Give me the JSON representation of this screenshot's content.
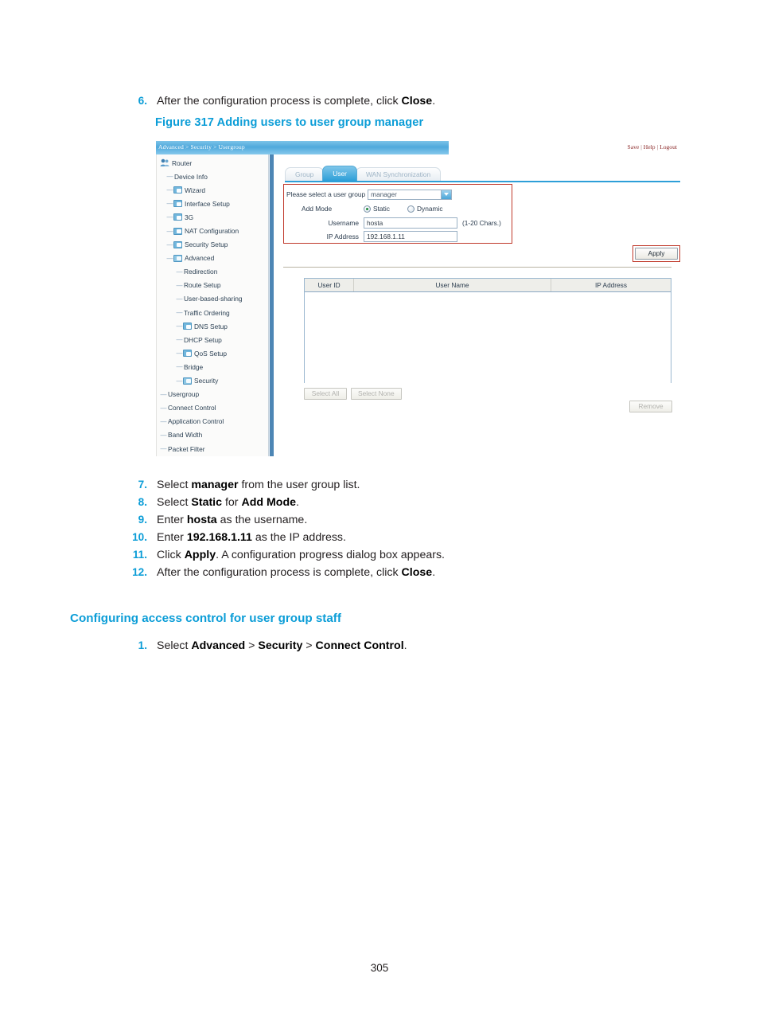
{
  "document": {
    "page_number": "305",
    "figure_caption": "Figure 317 Adding users to user group manager",
    "section_heading": "Configuring access control for user group staff",
    "steps_before_figure": [
      {
        "num": "6.",
        "html": "After the configuration process is complete, click <b>Close</b>."
      }
    ],
    "steps_after_figure": [
      {
        "num": "7.",
        "html": "Select <b>manager</b> from the user group list."
      },
      {
        "num": "8.",
        "html": "Select <b>Static</b> for <b>Add Mode</b>."
      },
      {
        "num": "9.",
        "html": "Enter <b>hosta</b> as the username."
      },
      {
        "num": "10.",
        "html": "Enter <b>192.168.1.11</b> as the IP address."
      },
      {
        "num": "11.",
        "html": "Click <b>Apply</b>. A configuration progress dialog box appears."
      },
      {
        "num": "12.",
        "html": "After the configuration process is complete, click <b>Close</b>."
      }
    ],
    "steps_section": [
      {
        "num": "1.",
        "html": "Select <b>Advanced</b> &gt; <b>Security</b> &gt; <b>Connect Control</b>."
      }
    ]
  },
  "screenshot": {
    "topbar": {
      "breadcrumb": "Advanced > Security > Usergroup",
      "account_links": [
        "Save",
        "Help",
        "Logout"
      ],
      "separator": "|"
    },
    "sidebar": {
      "root": {
        "label": "Router",
        "icon": "users-icon"
      },
      "items": [
        {
          "label": "Device Info",
          "level": 1,
          "icon": "none"
        },
        {
          "label": "Wizard",
          "level": 1,
          "icon": "folder-icon"
        },
        {
          "label": "Interface Setup",
          "level": 1,
          "icon": "folder-icon"
        },
        {
          "label": "3G",
          "level": 1,
          "icon": "folder-icon"
        },
        {
          "label": "NAT Configuration",
          "level": 1,
          "icon": "folder-icon"
        },
        {
          "label": "Security Setup",
          "level": 1,
          "icon": "folder-icon"
        },
        {
          "label": "Advanced",
          "level": 1,
          "icon": "folder-open-icon"
        },
        {
          "label": "Redirection",
          "level": 2,
          "icon": "none"
        },
        {
          "label": "Route Setup",
          "level": 2,
          "icon": "none"
        },
        {
          "label": "User-based-sharing",
          "level": 2,
          "icon": "none"
        },
        {
          "label": "Traffic Ordering",
          "level": 2,
          "icon": "none"
        },
        {
          "label": "DNS Setup",
          "level": 2,
          "icon": "folder-icon"
        },
        {
          "label": "DHCP Setup",
          "level": 2,
          "icon": "none"
        },
        {
          "label": "QoS Setup",
          "level": 2,
          "icon": "folder-icon"
        },
        {
          "label": "Bridge",
          "level": 2,
          "icon": "none"
        },
        {
          "label": "Security",
          "level": 2,
          "icon": "folder-open-icon"
        },
        {
          "label": "Usergroup",
          "level": 3,
          "icon": "none"
        },
        {
          "label": "Connect Control",
          "level": 3,
          "icon": "none"
        },
        {
          "label": "Application Control",
          "level": 3,
          "icon": "none"
        },
        {
          "label": "Band Width",
          "level": 3,
          "icon": "none"
        },
        {
          "label": "Packet Filter",
          "level": 3,
          "icon": "none"
        }
      ]
    },
    "tabs": [
      {
        "label": "Group",
        "active": false
      },
      {
        "label": "User",
        "active": true
      },
      {
        "label": "WAN Synchronization",
        "active": false
      }
    ],
    "form": {
      "usergroup_label": "Please select a user group",
      "usergroup_value": "manager",
      "add_mode_label": "Add Mode",
      "add_mode_options": [
        "Static",
        "Dynamic"
      ],
      "add_mode_selected": "Static",
      "username_label": "Username",
      "username_value": "hosta",
      "username_hint": "(1-20 Chars.)",
      "ip_label": "IP Address",
      "ip_value": "192.168.1.11",
      "apply_label": "Apply"
    },
    "table": {
      "columns": [
        "User ID",
        "User Name",
        "IP Address"
      ],
      "rows": []
    },
    "table_buttons": {
      "select_all": "Select All",
      "select_none": "Select None",
      "remove": "Remove"
    },
    "colors": {
      "accent_blue": "#0b9dd7",
      "tab_active": "#2e9fd8",
      "highlight_red": "#c0392b",
      "link_red": "#8c2a2a",
      "scrollbar": "#4d86b5"
    }
  }
}
